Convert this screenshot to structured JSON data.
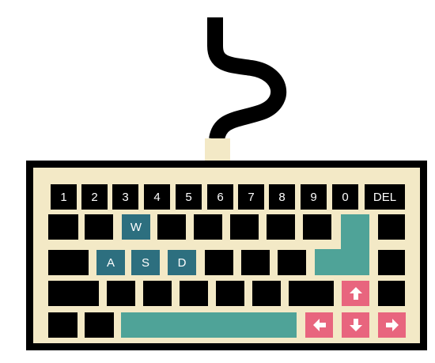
{
  "colors": {
    "key": "#000000",
    "case": "#f3e9c6",
    "letter_key": "#2d6f7f",
    "accent_key": "#4fa398",
    "arrow_key": "#e8657e",
    "legend": "#ffffff"
  },
  "keyboard": {
    "number_row": [
      "1",
      "2",
      "3",
      "4",
      "5",
      "6",
      "7",
      "8",
      "9",
      "0"
    ],
    "delete_label": "DEL",
    "key_w": "W",
    "key_a": "A",
    "key_s": "S",
    "key_d": "D"
  },
  "icons": {
    "up": "arrow-up-icon",
    "down": "arrow-down-icon",
    "left": "arrow-left-icon",
    "right": "arrow-right-icon",
    "cable": "cable-icon"
  }
}
